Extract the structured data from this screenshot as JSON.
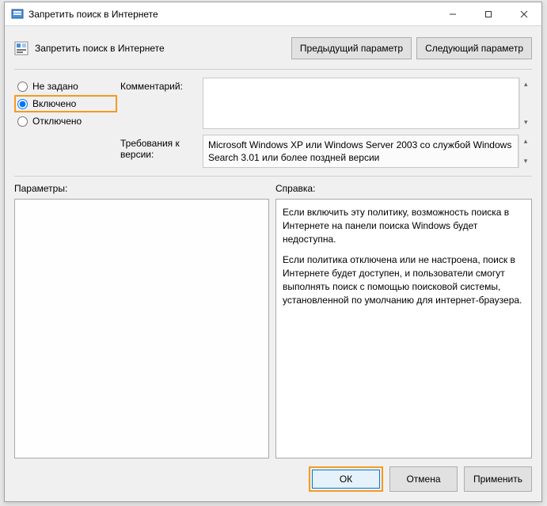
{
  "window": {
    "title": "Запретить поиск в Интернете"
  },
  "header": {
    "policy_title": "Запретить поиск в Интернете",
    "prev_btn": "Предыдущий параметр",
    "next_btn": "Следующий параметр"
  },
  "state": {
    "options": {
      "not_configured": "Не задано",
      "enabled": "Включено",
      "disabled": "Отключено"
    },
    "selected": "enabled"
  },
  "fields": {
    "comment_label": "Комментарий:",
    "comment_value": "",
    "requirements_label": "Требования к версии:",
    "requirements_value": "Microsoft Windows XP или Windows Server 2003 со службой Windows Search 3.01 или более поздней версии"
  },
  "sections": {
    "options_label": "Параметры:",
    "help_label": "Справка:",
    "help_text_p1": "Если включить эту политику, возможность поиска в Интернете на панели поиска Windows будет недоступна.",
    "help_text_p2": "Если политика отключена или не настроена, поиск в Интернете будет доступен, и пользователи смогут выполнять поиск с помощью поисковой системы, установленной по умолчанию для интернет-браузера."
  },
  "footer": {
    "ok": "ОК",
    "cancel": "Отмена",
    "apply": "Применить"
  }
}
